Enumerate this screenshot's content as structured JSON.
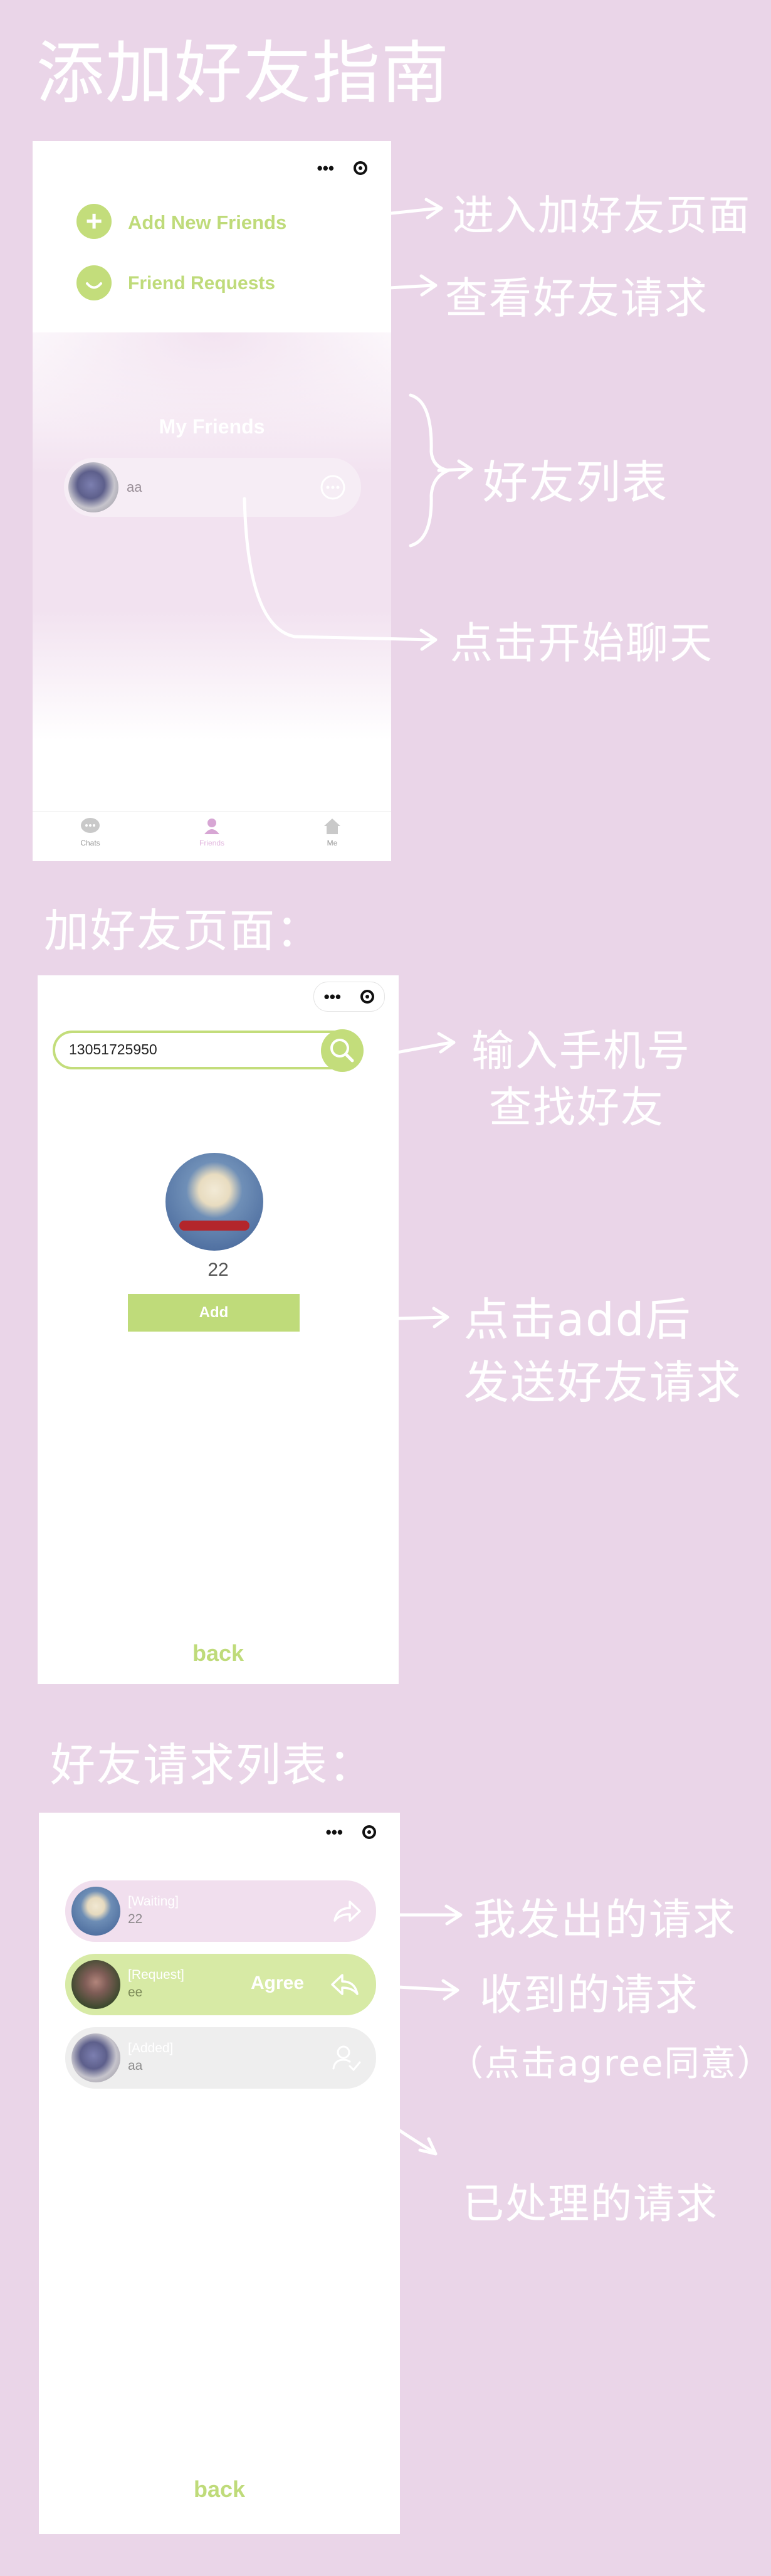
{
  "page_title": "添加好友指南",
  "section1": {
    "add_new_friends": "Add New Friends",
    "friend_requests": "Friend Requests",
    "my_friends": "My Friends",
    "friend_name": "aa",
    "tabs": [
      {
        "label": "Chats"
      },
      {
        "label": "Friends"
      },
      {
        "label": "Me"
      }
    ],
    "notes": {
      "enter_add_page": "进入加好友页面",
      "view_requests": "查看好友请求",
      "friend_list": "好友列表",
      "tap_to_chat": "点击开始聊天"
    }
  },
  "section2": {
    "heading": "加好友页面：",
    "search_value": "13051725950",
    "result_name": "22",
    "add_label": "Add",
    "back_label": "back",
    "notes": {
      "input_line1": "输入手机号",
      "input_line2": "查找好友",
      "add_line1": "点击add后",
      "add_line2": "发送好友请求"
    }
  },
  "section3": {
    "heading": "好友请求列表：",
    "requests": [
      {
        "status": "[Waiting]",
        "name": "22"
      },
      {
        "status": "[Request]",
        "name": "ee",
        "action": "Agree"
      },
      {
        "status": "[Added]",
        "name": "aa"
      }
    ],
    "back_label": "back",
    "notes": {
      "sent": "我发出的请求",
      "received": "收到的请求",
      "agree_hint": "（点击agree同意）",
      "processed": "已处理的请求"
    }
  },
  "colors": {
    "background": "#ead5e8",
    "accent_green": "#bfdb7a",
    "friend_pink": "#f2e2f0"
  }
}
